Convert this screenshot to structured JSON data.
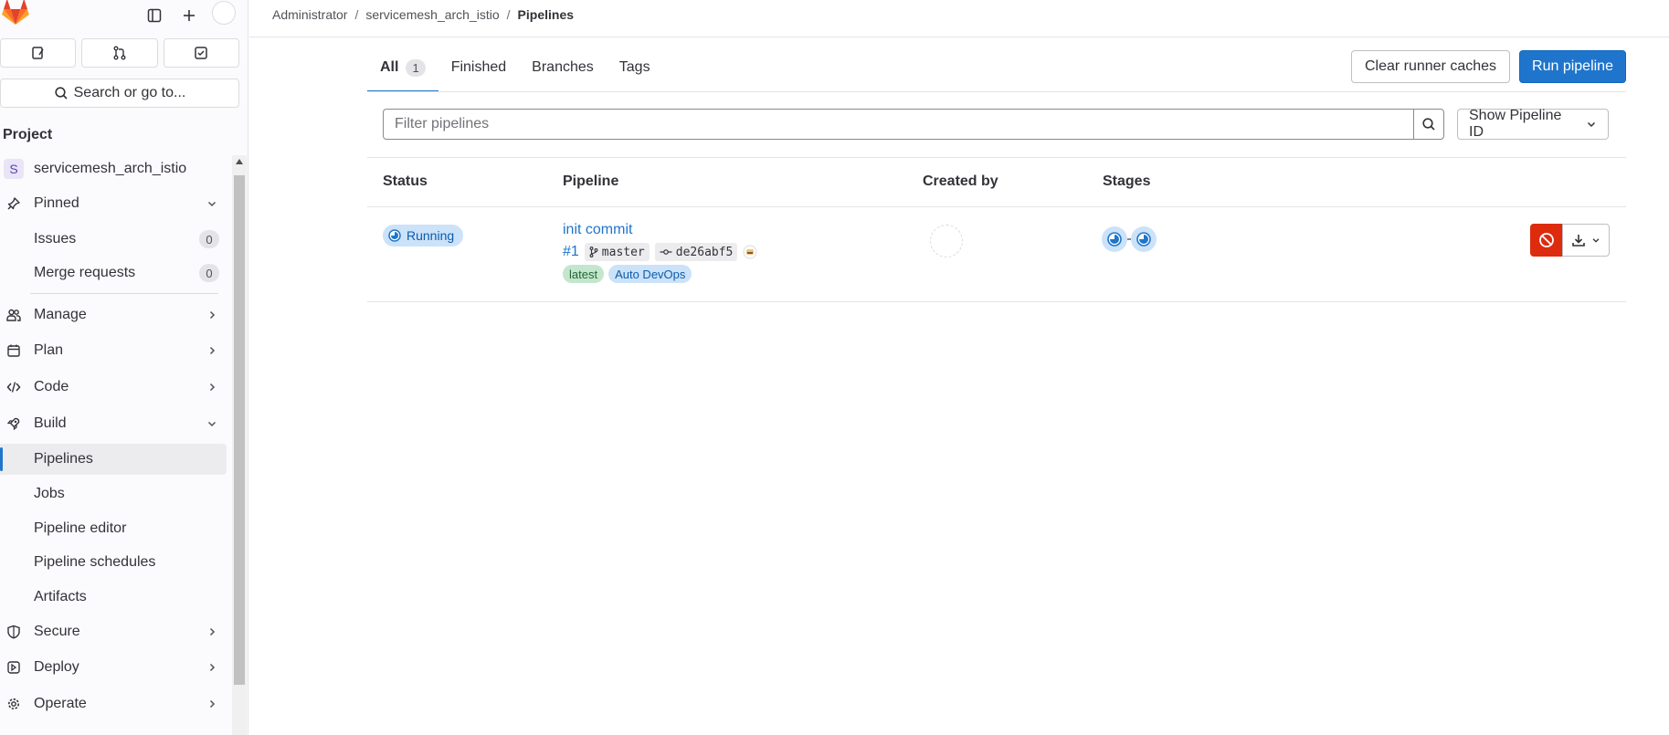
{
  "breadcrumb": {
    "items": [
      "Administrator",
      "servicemesh_arch_istio"
    ],
    "current": "Pipelines"
  },
  "sidebar": {
    "search_label": "Search or go to...",
    "section_title": "Project",
    "project": {
      "initial": "S",
      "name": "servicemesh_arch_istio"
    },
    "pinned": {
      "label": "Pinned"
    },
    "issues": {
      "label": "Issues",
      "count": "0"
    },
    "merge_requests": {
      "label": "Merge requests",
      "count": "0"
    },
    "manage": "Manage",
    "plan": "Plan",
    "code": "Code",
    "build": "Build",
    "build_children": [
      "Pipelines",
      "Jobs",
      "Pipeline editor",
      "Pipeline schedules",
      "Artifacts"
    ],
    "secure": "Secure",
    "deploy": "Deploy",
    "operate": "Operate"
  },
  "tabs": [
    {
      "label": "All",
      "count": "1"
    },
    {
      "label": "Finished"
    },
    {
      "label": "Branches"
    },
    {
      "label": "Tags"
    }
  ],
  "actions": {
    "clear_caches": "Clear runner caches",
    "run_pipeline": "Run pipeline"
  },
  "filter": {
    "placeholder": "Filter pipelines",
    "show_option": "Show Pipeline ID"
  },
  "table": {
    "headers": {
      "status": "Status",
      "pipeline": "Pipeline",
      "created_by": "Created by",
      "stages": "Stages"
    },
    "rows": [
      {
        "status": "Running",
        "title": "init commit",
        "id": "#1",
        "branch": "master",
        "commit": "de26abf5",
        "tags": [
          "latest",
          "Auto DevOps"
        ],
        "stages_icons": [
          "running-icon",
          "running-icon"
        ]
      }
    ]
  },
  "colors": {
    "primary": "#1f75cb",
    "danger": "#dd2b0e",
    "running_bg": "#cbe2f9",
    "latest_bg": "#c3e6cd"
  }
}
